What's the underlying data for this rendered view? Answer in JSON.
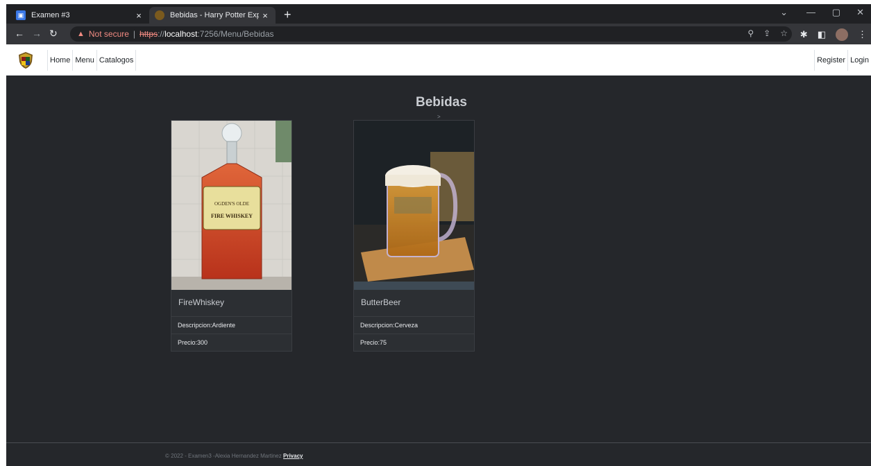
{
  "browser": {
    "tabs": [
      {
        "title": "Examen #3",
        "close": "×"
      },
      {
        "title": "Bebidas - Harry Potter Experienc",
        "close": "×"
      }
    ],
    "new_tab": "+",
    "address": {
      "warning": "Not secure",
      "separator": "|",
      "scheme": "https",
      "rest_scheme": "://",
      "host": "localhost",
      "path": ":7256/Menu/Bebidas"
    }
  },
  "nav": {
    "left": [
      "Home",
      "Menu",
      "Catalogos"
    ],
    "right": [
      "Register",
      "Login"
    ]
  },
  "page": {
    "title": "Bebidas",
    "chevron": ">"
  },
  "cards": [
    {
      "name": "FireWhiskey",
      "description": "Descripcion:Ardiente",
      "price": "Precio:300",
      "label_lines": [
        "OGDEN'S OLDE",
        "FIRE WHISKEY"
      ]
    },
    {
      "name": "ButterBeer",
      "description": "Descripcion:Cerveza",
      "price": "Precio:75"
    }
  ],
  "footer": {
    "text": "© 2022 - Examen3 -Alexia Hernandez Martinez",
    "link": "Privacy"
  },
  "colors": {
    "page_bg": "#25272b",
    "card_bg": "#2c2f33",
    "chrome_dark": "#202124",
    "chrome_toolbar": "#35363a",
    "warning": "#f28b82"
  }
}
